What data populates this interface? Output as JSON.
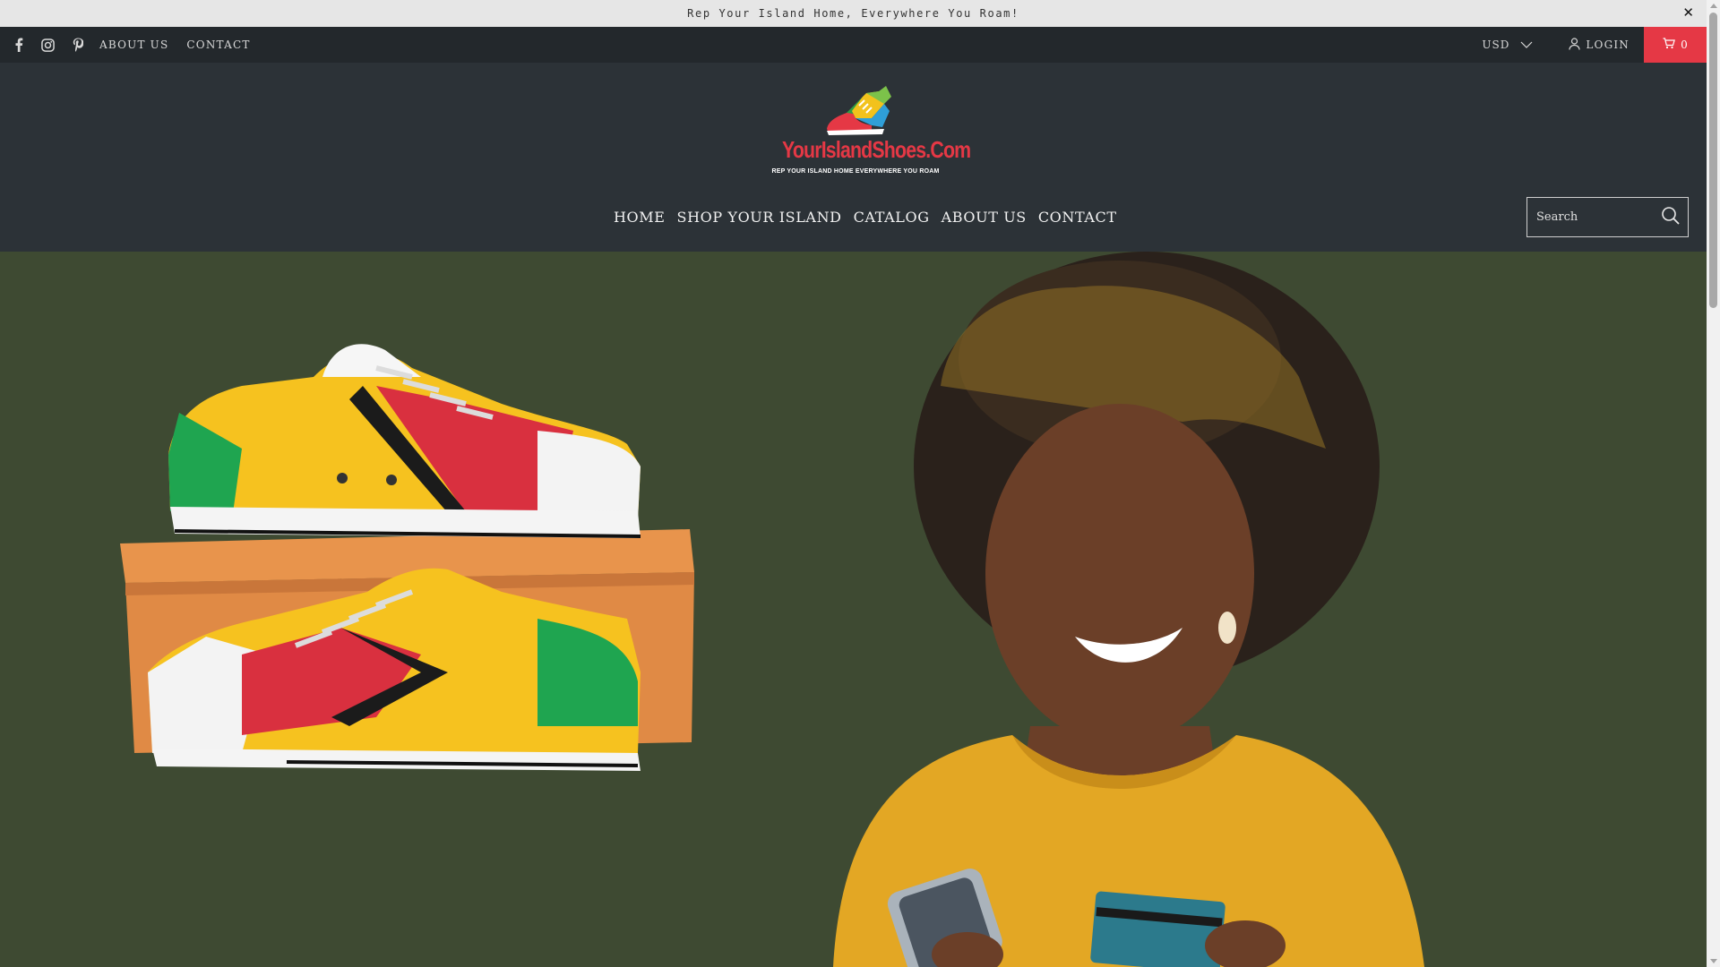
{
  "announcement": {
    "text": "Rep Your Island Home, Everywhere You Roam!",
    "close_icon": "close-icon"
  },
  "topbar": {
    "social_icons": [
      "facebook-icon",
      "instagram-icon",
      "pinterest-icon"
    ],
    "links": [
      "ABOUT US",
      "CONTACT"
    ],
    "currency": "USD",
    "login": "LOGIN",
    "cart_count": "0"
  },
  "header": {
    "logo_text": "YourIslandShoes.Com",
    "logo_tagline": "REP YOUR ISLAND HOME EVERYWHERE YOU ROAM",
    "nav": [
      "HOME",
      "SHOP YOUR ISLAND",
      "CATALOG",
      "ABOUT US",
      "CONTACT"
    ],
    "search_placeholder": "Search"
  },
  "colors": {
    "accent": "#e53845",
    "topbar_bg": "#23282c",
    "header_bg": "#2c3237",
    "hero_bg": "#3e4a32"
  }
}
